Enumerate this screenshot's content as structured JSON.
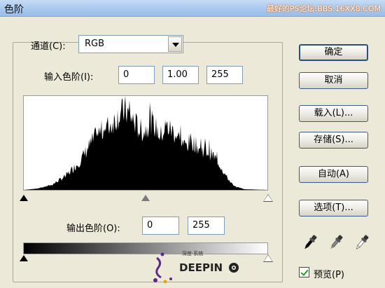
{
  "window": {
    "title": "色阶",
    "watermark": "最好的PS论坛:BBS.16XX8.COM"
  },
  "channel": {
    "label": "通道(C):",
    "value": "RGB"
  },
  "input_levels": {
    "label": "输入色阶(I):",
    "black": "0",
    "gamma": "1.00",
    "white": "255"
  },
  "output_levels": {
    "label": "输出色阶(O):",
    "black": "0",
    "white": "255"
  },
  "buttons": {
    "ok": "确定",
    "cancel": "取消",
    "load": "载入(L)...",
    "save": "存储(S)...",
    "auto": "自动(A)",
    "options": "选项(T)..."
  },
  "preview": {
    "label": "预览(P)",
    "checked": true
  },
  "logo": {
    "caption": "深度·系统",
    "brand": "DEEPIN"
  },
  "icons": {
    "black_eyedropper": "eyedropper-black-icon",
    "gray_eyedropper": "eyedropper-gray-icon",
    "white_eyedropper": "eyedropper-white-icon"
  }
}
